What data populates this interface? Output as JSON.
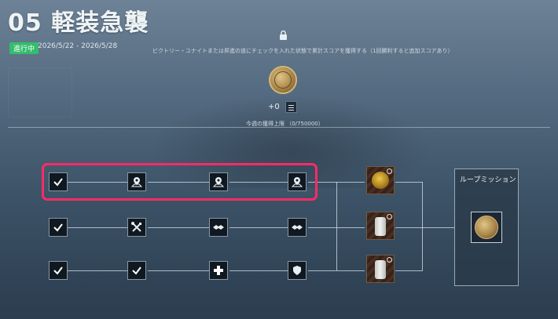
{
  "event": {
    "title": "05 軽装急襲",
    "status": "進行中",
    "date_range": "2026/5/22 - 2026/5/28",
    "description": "ビクトリー・ユナイトまたは昇進の道にチェックを入れた状態で累計スコアを獲得する（1回勝利すると追加スコアあり）"
  },
  "reward": {
    "score": "+0",
    "weekly_cap": "今週の獲得上限 （0/750000）"
  },
  "loop_mission": {
    "title": "ループミッション"
  },
  "mission_rows": [
    {
      "nodes": [
        "check-icon",
        "map-pin-icon",
        "map-pin-icon",
        "map-pin-icon"
      ],
      "reward": "fruit-chest",
      "highlighted": true
    },
    {
      "nodes": [
        "check-icon",
        "tools-icon",
        "handshake-icon",
        "handshake-icon"
      ],
      "reward": "armor-chest",
      "highlighted": false
    },
    {
      "nodes": [
        "check-icon",
        "check-icon",
        "plus-icon",
        "shield-icon"
      ],
      "reward": "armor-chest",
      "highlighted": false
    }
  ],
  "colors": {
    "status_green": "#34bd6e",
    "highlight": "#ff2a67",
    "medal_gold": "#c9a565"
  }
}
